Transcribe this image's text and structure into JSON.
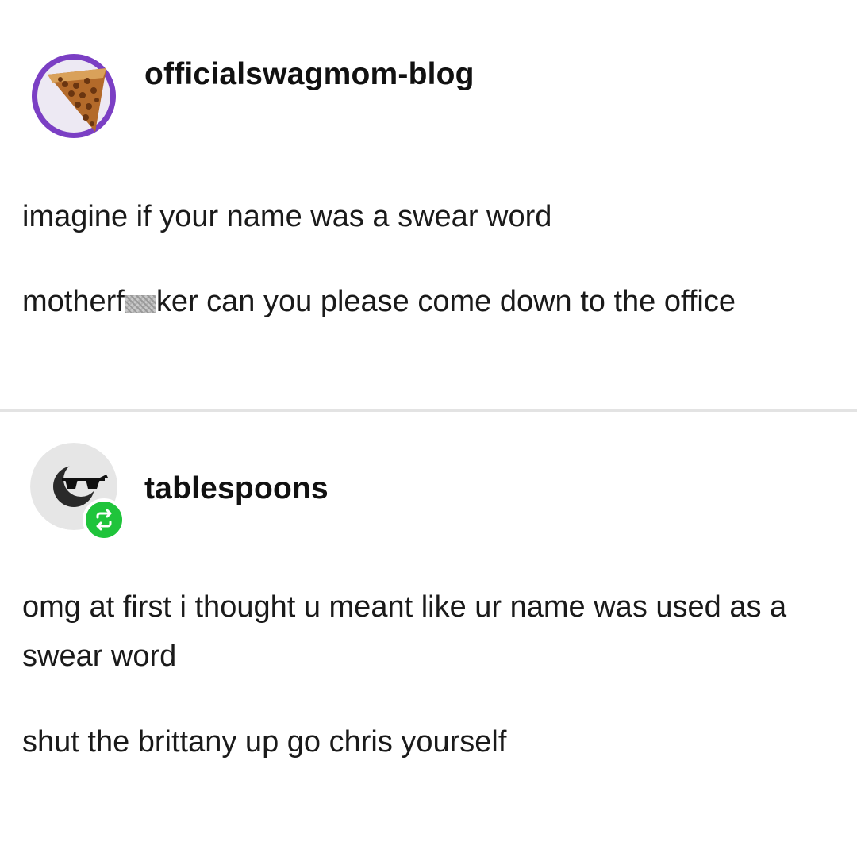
{
  "posts": [
    {
      "username": "officialswagmom-blog",
      "avatar_icon": "pie-slice-icon",
      "avatar_ring_color": "#7b3fc4",
      "paragraphs": [
        {
          "text": "imagine if your name was a swear word"
        },
        {
          "before_censor": "motherf",
          "after_censor": "ker can you please come down to the office"
        }
      ]
    },
    {
      "username": "tablespoons",
      "avatar_icon": "sunglasses-moon-icon",
      "reblog_icon": "reblog-icon",
      "reblog_color": "#1fc43b",
      "paragraphs": [
        {
          "text": "omg at first i thought u meant like ur name was used as a swear word"
        },
        {
          "text": "shut the brittany up go chris yourself"
        }
      ]
    }
  ]
}
